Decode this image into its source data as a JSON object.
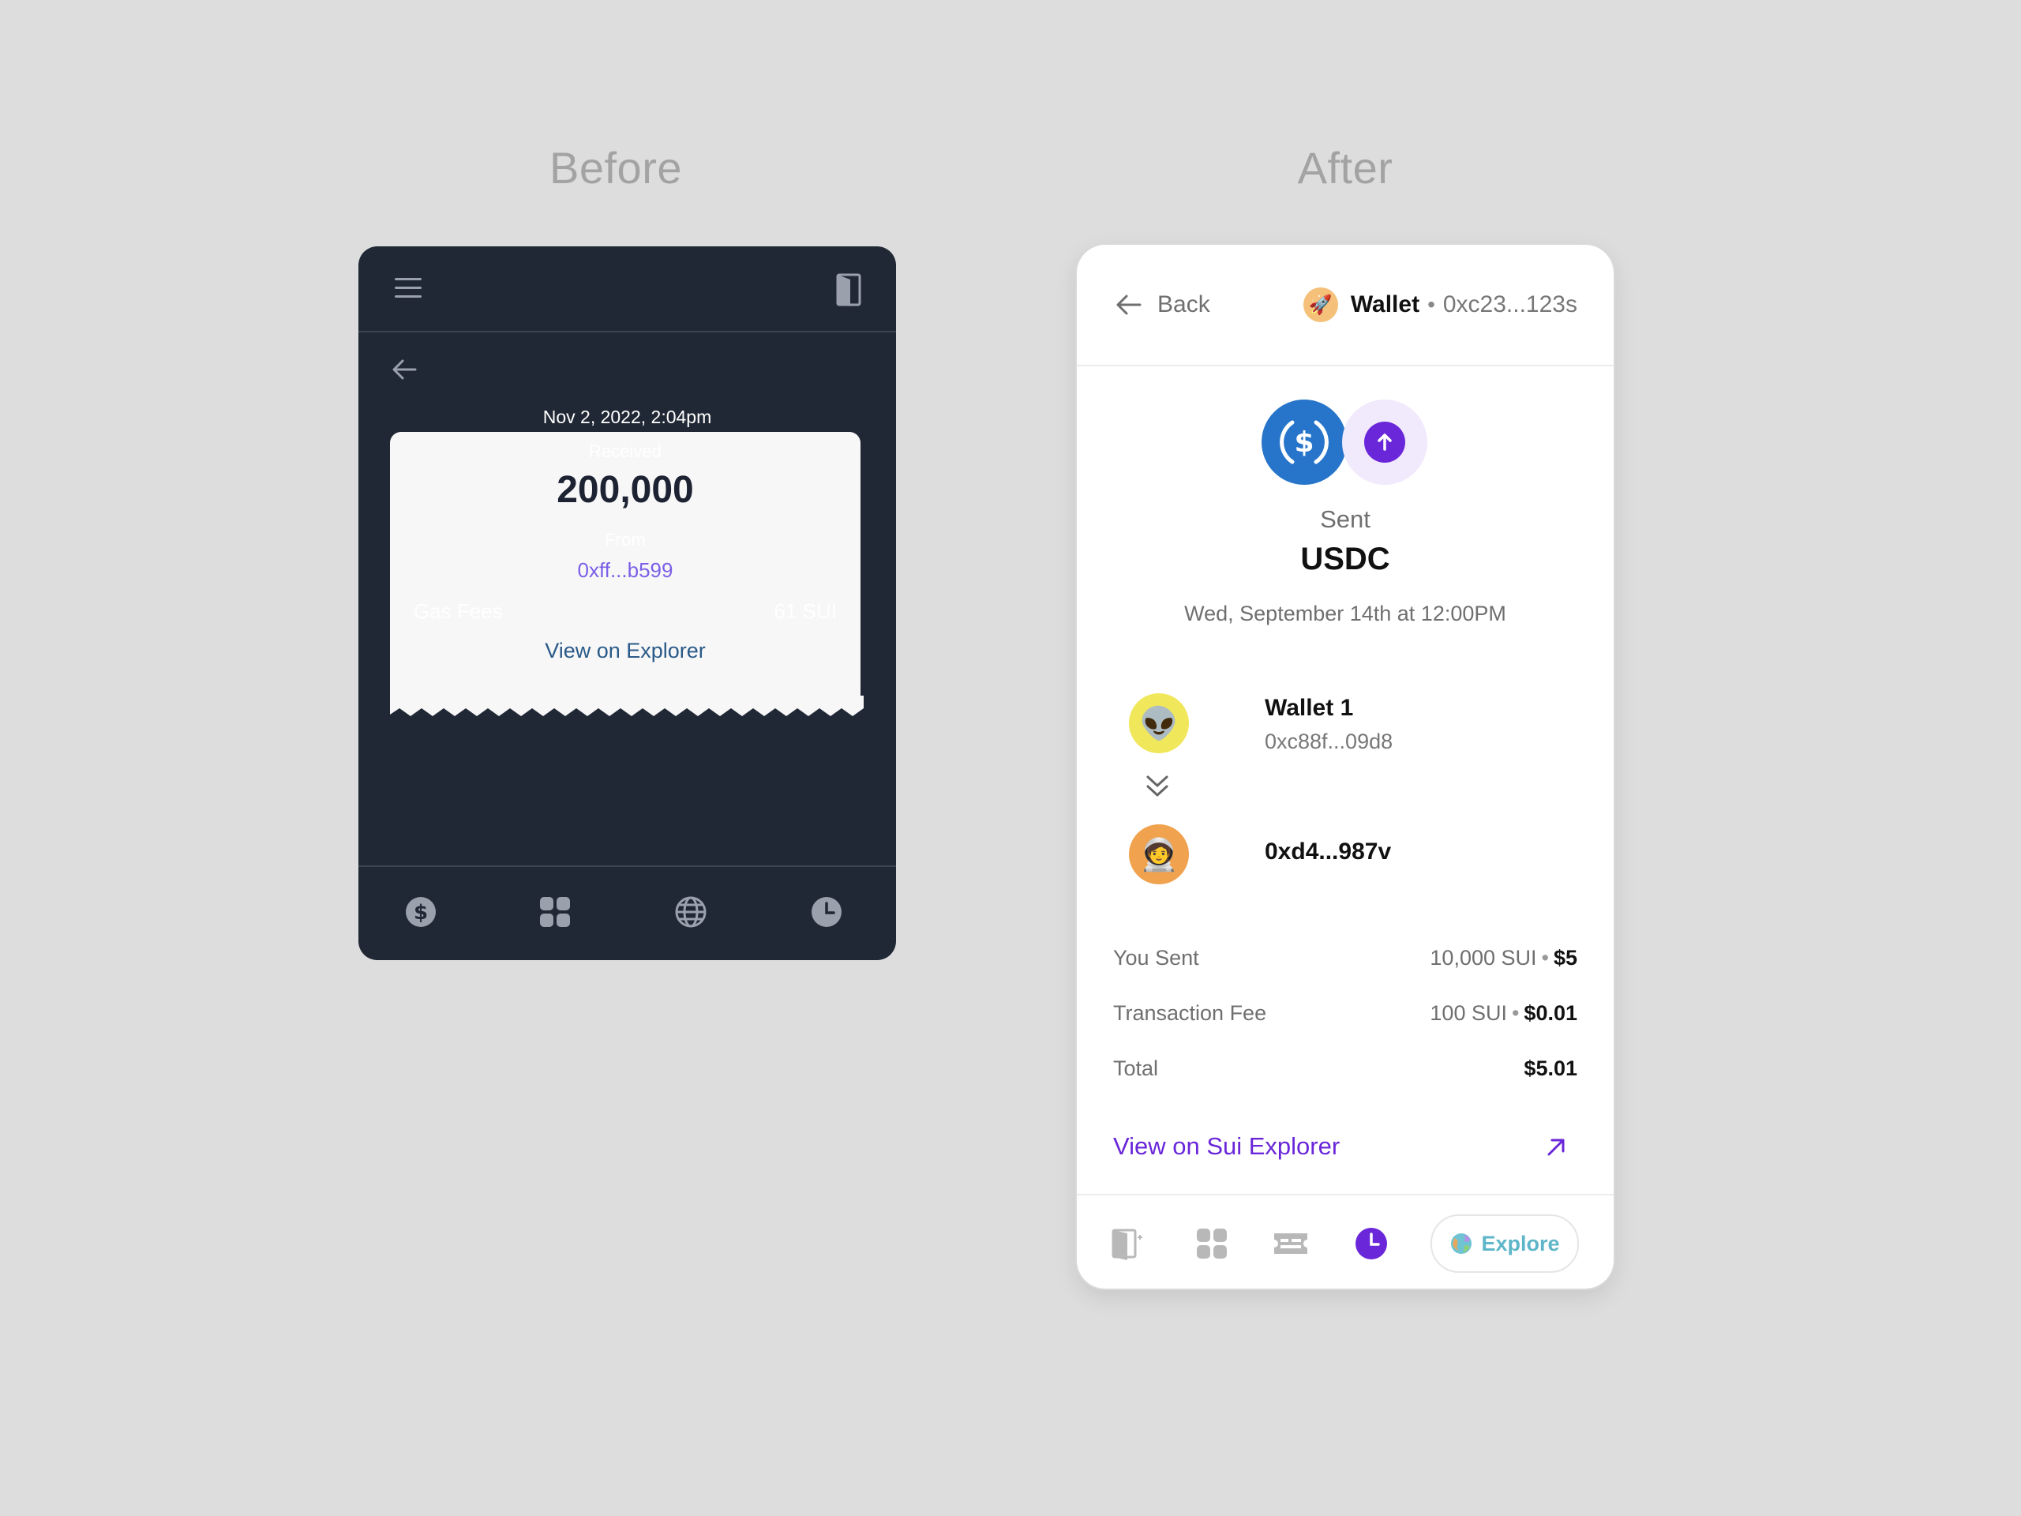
{
  "headings": {
    "before": "Before",
    "after": "After"
  },
  "before": {
    "date": "Nov 2, 2022, 2:04pm",
    "received_label": "Received",
    "amount": "200,000",
    "from_label": "From",
    "from_address": "0xff...b599",
    "gas_label": "Gas Fees",
    "gas_value": "61 SUI",
    "explorer_link": "View on Explorer",
    "nav_icons": [
      "dollar-icon",
      "apps-icon",
      "globe-icon",
      "clock-icon"
    ]
  },
  "after": {
    "back_label": "Back",
    "wallet_name": "Wallet",
    "wallet_separator": "•",
    "wallet_address": "0xc23...123s",
    "status": "Sent",
    "token": "USDC",
    "datetime": "Wed, September 14th at 12:00PM",
    "from": {
      "name": "Wallet 1",
      "address": "0xc88f...09d8",
      "emoji": "👽"
    },
    "to": {
      "address": "0xd4...987v",
      "emoji": "🧑‍🚀"
    },
    "rows": [
      {
        "label": "You Sent",
        "amount": "10,000 SUI",
        "usd": "$5"
      },
      {
        "label": "Transaction Fee",
        "amount": "100 SUI",
        "usd": "$0.01"
      },
      {
        "label": "Total",
        "amount": "",
        "usd": "$5.01"
      }
    ],
    "explorer_link": "View on Sui Explorer",
    "explore_button": "Explore",
    "colors": {
      "accent": "#6a26d9",
      "usdc": "#2775ca",
      "explore": "#5eb6c8"
    }
  }
}
